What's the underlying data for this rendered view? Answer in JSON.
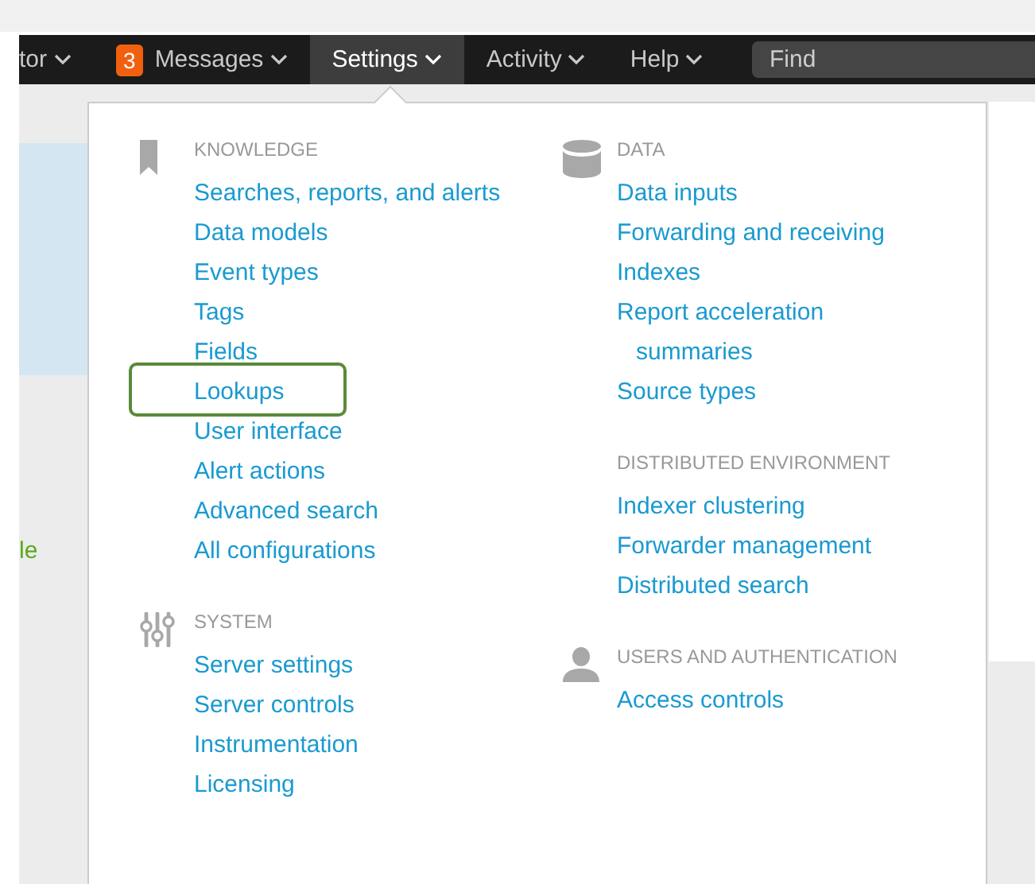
{
  "navbar": {
    "items": [
      {
        "label": "tor",
        "selected": false
      },
      {
        "label": "Messages",
        "badge": "3",
        "selected": false
      },
      {
        "label": "Settings",
        "selected": true
      },
      {
        "label": "Activity",
        "selected": false
      },
      {
        "label": "Help",
        "selected": false
      }
    ],
    "search": {
      "placeholder": "Find"
    }
  },
  "background": {
    "side_text": "le"
  },
  "settings_menu": {
    "columns": [
      {
        "sections": [
          {
            "heading": "KNOWLEDGE",
            "items": [
              {
                "label": "Searches, reports, and alerts",
                "highlighted": false
              },
              {
                "label": "Data models",
                "highlighted": false
              },
              {
                "label": "Event types",
                "highlighted": false
              },
              {
                "label": "Tags",
                "highlighted": false
              },
              {
                "label": "Fields",
                "highlighted": false
              },
              {
                "label": "Lookups",
                "highlighted": true
              },
              {
                "label": "User interface",
                "highlighted": false
              },
              {
                "label": "Alert actions",
                "highlighted": false
              },
              {
                "label": "Advanced search",
                "highlighted": false
              },
              {
                "label": "All configurations",
                "highlighted": false
              }
            ]
          },
          {
            "heading": "SYSTEM",
            "items": [
              {
                "label": "Server settings",
                "highlighted": false
              },
              {
                "label": "Server controls",
                "highlighted": false
              },
              {
                "label": "Instrumentation",
                "highlighted": false
              },
              {
                "label": "Licensing",
                "highlighted": false
              }
            ]
          }
        ]
      },
      {
        "sections": [
          {
            "heading": "DATA",
            "items": [
              {
                "label": "Data inputs",
                "highlighted": false
              },
              {
                "label": "Forwarding and receiving",
                "highlighted": false
              },
              {
                "label": "Indexes",
                "highlighted": false
              },
              {
                "label": "Report acceleration summaries",
                "highlighted": false
              },
              {
                "label": "Source types",
                "highlighted": false
              }
            ]
          },
          {
            "heading": "DISTRIBUTED ENVIRONMENT",
            "items": [
              {
                "label": "Indexer clustering",
                "highlighted": false
              },
              {
                "label": "Forwarder management",
                "highlighted": false
              },
              {
                "label": "Distributed search",
                "highlighted": false
              }
            ]
          },
          {
            "heading": "USERS AND AUTHENTICATION",
            "items": [
              {
                "label": "Access controls",
                "highlighted": false
              }
            ]
          }
        ]
      }
    ]
  }
}
